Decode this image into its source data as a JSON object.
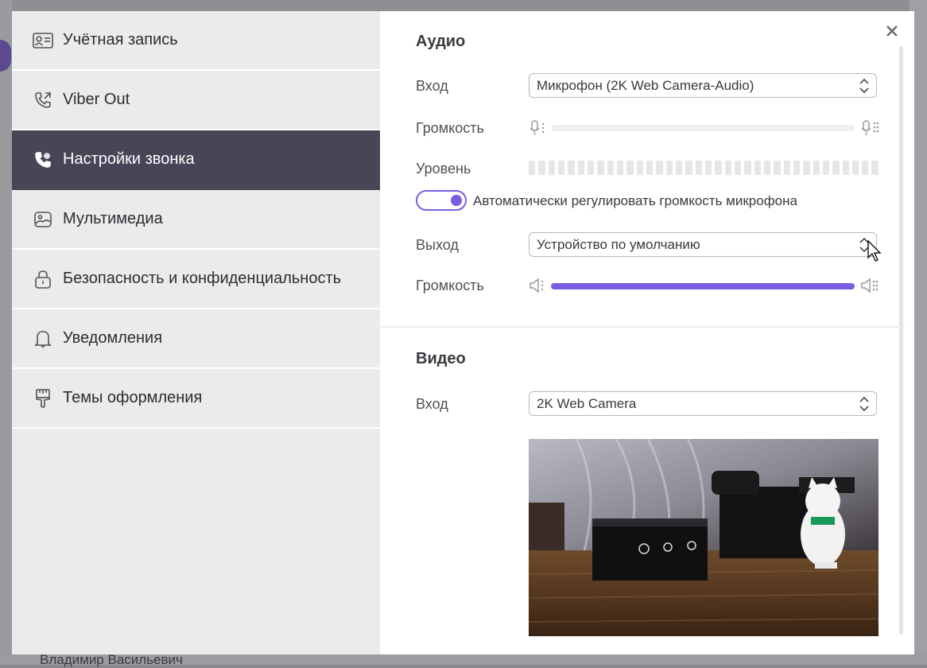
{
  "background": {
    "bottom_name": "Владимир Васильевич"
  },
  "sidebar": {
    "items": [
      {
        "label": "Учётная запись",
        "icon": "account-card-icon",
        "active": false
      },
      {
        "label": "Viber Out",
        "icon": "phone-out-icon",
        "active": false
      },
      {
        "label": "Настройки звонка",
        "icon": "call-settings-icon",
        "active": true
      },
      {
        "label": "Мультимедиа",
        "icon": "media-icon",
        "active": false
      },
      {
        "label": "Безопасность и конфиденциальность",
        "icon": "lock-icon",
        "active": false
      },
      {
        "label": "Уведомления",
        "icon": "bell-icon",
        "active": false
      },
      {
        "label": "Темы оформления",
        "icon": "brush-icon",
        "active": false
      }
    ]
  },
  "audio": {
    "title": "Аудио",
    "input_label": "Вход",
    "input_value": "Микрофон (2K Web Camera-Audio)",
    "input_volume_label": "Громкость",
    "input_volume": 0,
    "level_label": "Уровень",
    "auto_gain_label": "Автоматически регулировать громкость микрофона",
    "auto_gain_on": true,
    "output_label": "Выход",
    "output_value": "Устройство по умолчанию",
    "output_volume_label": "Громкость",
    "output_volume": 1.0
  },
  "video": {
    "title": "Видео",
    "input_label": "Вход",
    "input_value": "2K Web Camera"
  },
  "colors": {
    "accent": "#7b5ee0",
    "sidebar_active": "#4a4457",
    "sidebar_bg": "#eaebeb"
  }
}
